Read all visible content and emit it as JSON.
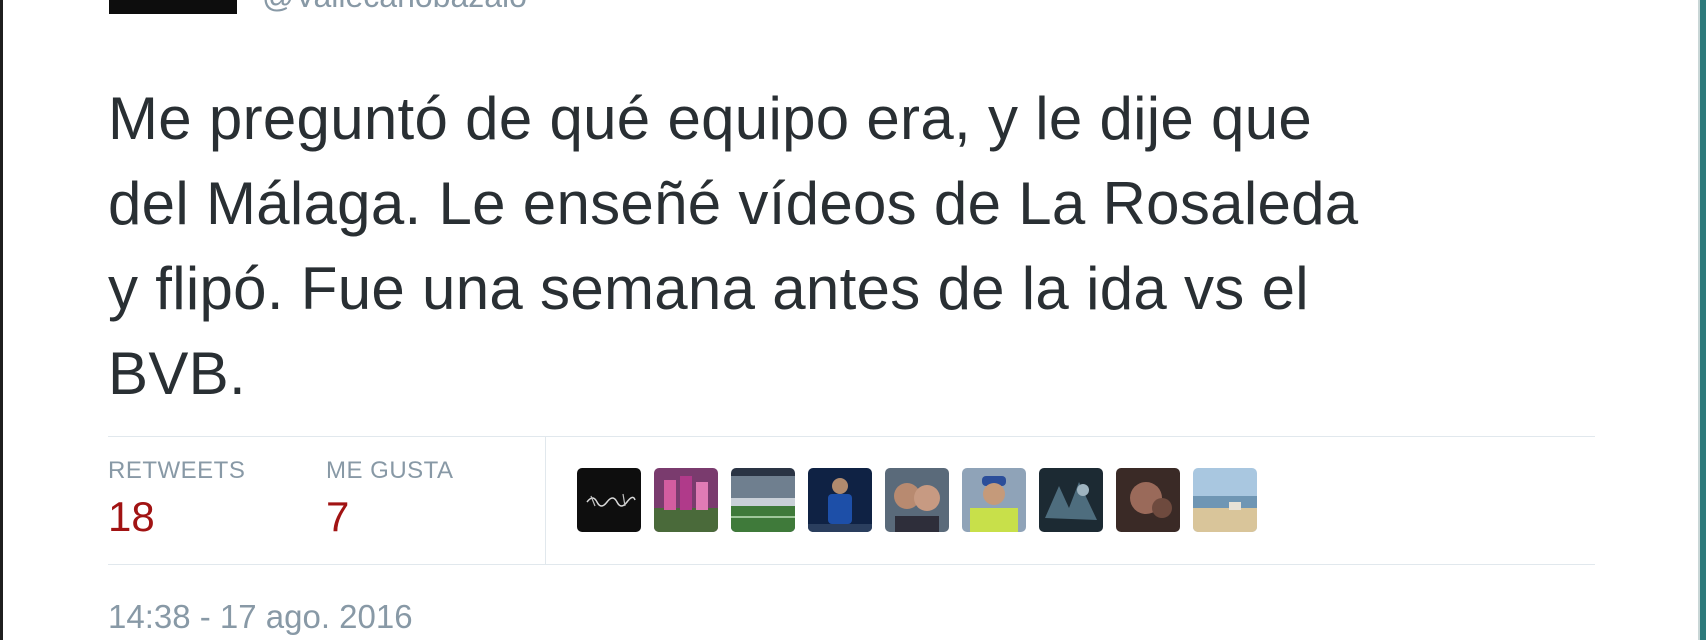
{
  "tweet": {
    "handle": "@Vallecanobazalo",
    "text_lines": [
      "Me preguntó de qué equipo era, y le dije que",
      "del Málaga. Le enseñé vídeos de La Rosaleda",
      "y flipó. Fue una semana antes de la ida vs el",
      "BVB."
    ],
    "timestamp": "14:38 - 17 ago. 2016"
  },
  "stats": {
    "retweets_label": "RETWEETS",
    "retweets_value": "18",
    "likes_label": "ME GUSTA",
    "likes_value": "7"
  },
  "favoriters": [
    {
      "name": "avatar-1"
    },
    {
      "name": "avatar-2"
    },
    {
      "name": "avatar-3"
    },
    {
      "name": "avatar-4"
    },
    {
      "name": "avatar-5"
    },
    {
      "name": "avatar-6"
    },
    {
      "name": "avatar-7"
    },
    {
      "name": "avatar-8"
    },
    {
      "name": "avatar-9"
    }
  ],
  "colors": {
    "count_red": "#a11313",
    "muted": "#8899a6",
    "text": "#292f33",
    "divider": "#e1e8ed"
  }
}
